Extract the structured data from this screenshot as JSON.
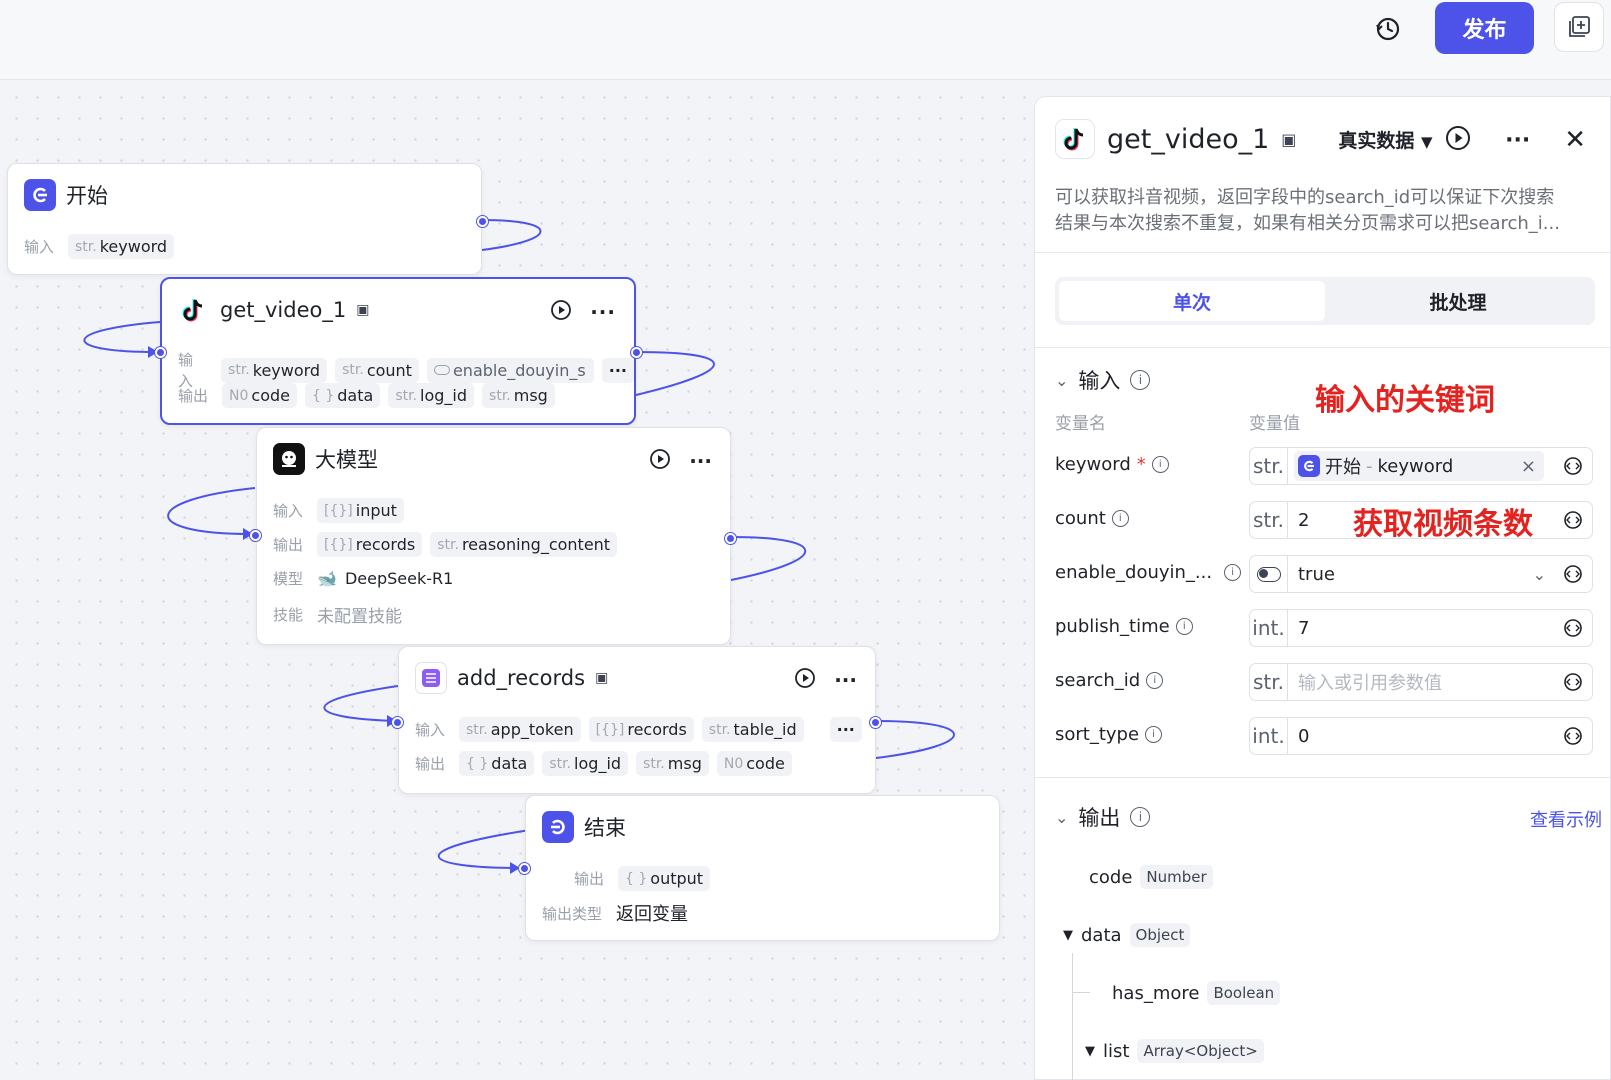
{
  "toolbar": {
    "publish_label": "发布"
  },
  "nodes": {
    "start": {
      "title": "开始",
      "input_label": "输入",
      "inputs": [
        {
          "type": "str.",
          "name": "keyword"
        }
      ]
    },
    "get_video": {
      "title": "get_video_1",
      "input_label": "输入",
      "output_label": "输出",
      "inputs": [
        {
          "type": "str.",
          "name": "keyword"
        },
        {
          "type": "str.",
          "name": "count"
        },
        {
          "type": "",
          "name": "enable_douyin_s"
        }
      ],
      "more": "···",
      "outputs": [
        {
          "type": "N0",
          "name": "code"
        },
        {
          "type": "{ }",
          "name": "data"
        },
        {
          "type": "str.",
          "name": "log_id"
        },
        {
          "type": "str.",
          "name": "msg"
        }
      ]
    },
    "llm": {
      "title": "大模型",
      "input_label": "输入",
      "output_label": "输出",
      "model_label": "模型",
      "skill_label": "技能",
      "inputs": [
        {
          "type": "[{}]",
          "name": "input"
        }
      ],
      "outputs": [
        {
          "type": "[{}]",
          "name": "records"
        },
        {
          "type": "str.",
          "name": "reasoning_content"
        }
      ],
      "model": "DeepSeek-R1",
      "skill": "未配置技能"
    },
    "add_records": {
      "title": "add_records",
      "input_label": "输入",
      "output_label": "输出",
      "inputs": [
        {
          "type": "str.",
          "name": "app_token"
        },
        {
          "type": "[{}]",
          "name": "records"
        },
        {
          "type": "str.",
          "name": "table_id"
        }
      ],
      "more": "···",
      "outputs": [
        {
          "type": "{ }",
          "name": "data"
        },
        {
          "type": "str.",
          "name": "log_id"
        },
        {
          "type": "str.",
          "name": "msg"
        },
        {
          "type": "N0",
          "name": "code"
        }
      ]
    },
    "end": {
      "title": "结束",
      "output_label": "输出",
      "outputs": [
        {
          "type": "{ }",
          "name": "output"
        }
      ],
      "output_type_label": "输出类型",
      "output_type": "返回变量"
    }
  },
  "panel": {
    "name": "get_video_1",
    "mode": "真实数据",
    "description_line1": "可以获取抖音视频，返回字段中的search_id可以保证下次搜索",
    "description_line2": "结果与本次搜索不重复，如果有相关分页需求可以把search_i...",
    "tabs": [
      "单次",
      "批处理"
    ],
    "input_section": "输入",
    "col_name": "变量名",
    "col_value": "变量值",
    "params": [
      {
        "name": "keyword",
        "required": "*",
        "type": "str.",
        "ref_node": "开始",
        "ref_sep": " - ",
        "ref_var": "keyword",
        "clear": "×"
      },
      {
        "name": "count",
        "type": "str.",
        "value": "2"
      },
      {
        "name": "enable_douyin_...",
        "value": "true"
      },
      {
        "name": "publish_time",
        "type": "int.",
        "value": "7"
      },
      {
        "name": "search_id",
        "type": "str.",
        "placeholder": "输入或引用参数值"
      },
      {
        "name": "sort_type",
        "type": "int.",
        "value": "0"
      }
    ],
    "annotations": {
      "keyword": "输入的关键词",
      "count": "获取视频条数"
    },
    "output_section": "输出",
    "view_example": "查看示例",
    "outputs": [
      {
        "name": "code",
        "type": "Number"
      },
      {
        "name": "data",
        "type": "Object"
      },
      {
        "name": "has_more",
        "type": "Boolean"
      },
      {
        "name": "list",
        "type": "Array<Object>"
      }
    ]
  },
  "colors": {
    "accent": "#4d53e8",
    "annotation": "#e3231f"
  }
}
